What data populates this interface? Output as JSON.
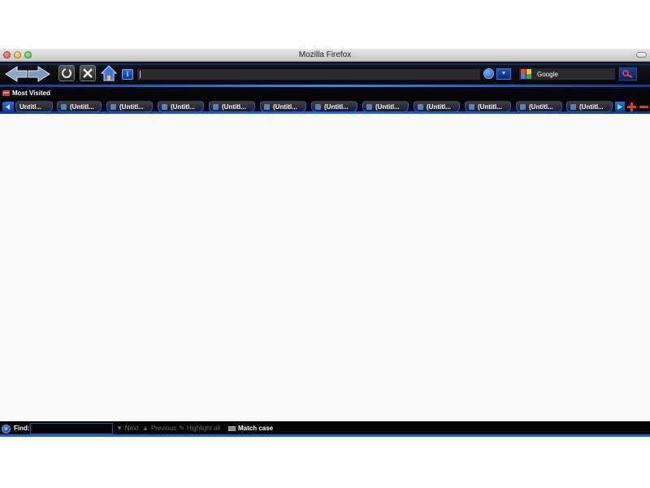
{
  "window": {
    "title": "Mozilla Firefox"
  },
  "toolbar": {
    "url_value": "",
    "site_identity_label": "i",
    "search_engine": "Google",
    "search_value": ""
  },
  "bookmarks": {
    "items": [
      {
        "label": "Most Visited",
        "icon": "most-visited-icon"
      }
    ]
  },
  "tabs": [
    {
      "title": "Untitl..."
    },
    {
      "title": "(Untitl..."
    },
    {
      "title": "(Untitl..."
    },
    {
      "title": "(Untitl..."
    },
    {
      "title": "(Untitl..."
    },
    {
      "title": "(Untitl..."
    },
    {
      "title": "(Untitl..."
    },
    {
      "title": "(Untitl..."
    },
    {
      "title": "(Untitl..."
    },
    {
      "title": "(Untitl..."
    },
    {
      "title": "(Untitl..."
    },
    {
      "title": "(Untitl..."
    }
  ],
  "findbar": {
    "label": "Find:",
    "input_value": "",
    "next_label": "Next",
    "previous_label": "Previous",
    "highlight_label": "Highlight all",
    "match_case_label": "Match case"
  },
  "colors": {
    "accent": "#1e6ee6",
    "toolbar_bg": "#060608"
  }
}
